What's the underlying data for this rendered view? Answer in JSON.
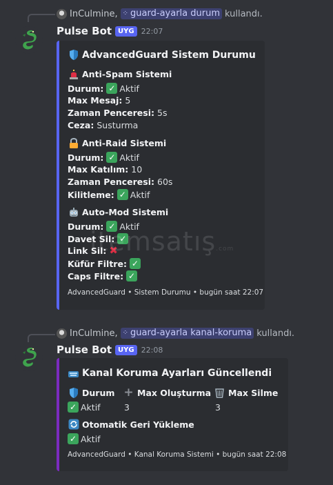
{
  "messages": [
    {
      "reply": {
        "user": "InCulmine,",
        "command": "guard-ayarla durum",
        "suffix": "kullandı."
      },
      "author": {
        "name": "Pulse Bot",
        "tag": "UYG",
        "time": "22:07"
      },
      "embed": {
        "title": "AdvancedGuard Sistem Durumu",
        "sections": [
          {
            "title": "Anti-Spam Sistemi",
            "icon": "siren-icon",
            "lines": [
              {
                "label": "Durum:",
                "value": "Aktif",
                "check": true
              },
              {
                "label": "Max Mesaj:",
                "value": "5"
              },
              {
                "label": "Zaman Penceresi:",
                "value": "5s"
              },
              {
                "label": "Ceza:",
                "value": "Susturma"
              }
            ]
          },
          {
            "title": "Anti-Raid Sistemi",
            "icon": "lock-icon",
            "lines": [
              {
                "label": "Durum:",
                "value": "Aktif",
                "check": true
              },
              {
                "label": "Max Katılım:",
                "value": "10"
              },
              {
                "label": "Zaman Penceresi:",
                "value": "60s"
              },
              {
                "label": "Kilitleme:",
                "value": "Aktif",
                "check": true
              }
            ]
          },
          {
            "title": "Auto-Mod Sistemi",
            "icon": "robot-icon",
            "lines": [
              {
                "label": "Durum:",
                "value": "Aktif",
                "check": true
              },
              {
                "label": "Davet Sil:",
                "value": "",
                "check": true
              },
              {
                "label": "Link Sil:",
                "value": "",
                "cross": true
              },
              {
                "label": "Küfür Filtre:",
                "value": "",
                "check": true
              },
              {
                "label": "Caps Filtre:",
                "value": "",
                "check": true
              }
            ]
          }
        ],
        "footer": "AdvancedGuard • Sistem Durumu • bugün saat 22:07"
      }
    },
    {
      "reply": {
        "user": "InCulmine,",
        "command": "guard-ayarla kanal-koruma",
        "suffix": "kullandı."
      },
      "author": {
        "name": "Pulse Bot",
        "tag": "UYG",
        "time": "22:08"
      },
      "embed": {
        "title": "Kanal Koruma Ayarları Güncellendi",
        "fields": [
          {
            "name": "Durum",
            "icon": "shield-icon",
            "value": "Aktif",
            "check": true
          },
          {
            "name": "Max Oluşturma",
            "icon": "plus-icon",
            "value": "3"
          },
          {
            "name": "Max Silme",
            "icon": "wastebasket-icon",
            "value": "3"
          },
          {
            "name": "Otomatik Geri Yükleme",
            "icon": "refresh-icon",
            "value": "Aktif",
            "check": true
          }
        ],
        "footer": "AdvancedGuard • Kanal Koruma Sistemi • bugün saat 22:08"
      }
    }
  ],
  "watermark": {
    "text": "itemsatış",
    "suffix": ".com"
  }
}
